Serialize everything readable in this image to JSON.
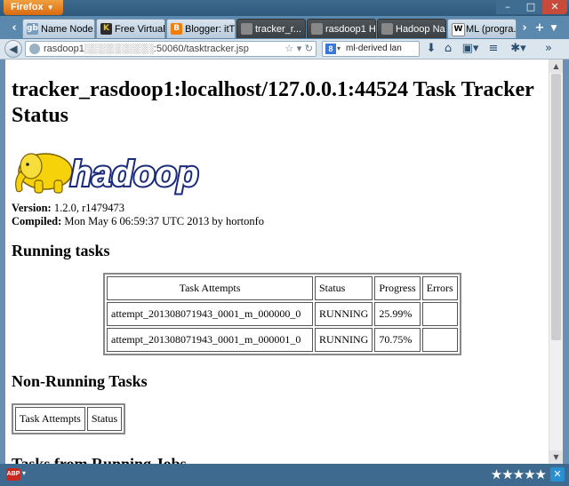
{
  "browser": {
    "menu_label": "Firefox",
    "url": "rasdoop1░░░░░░░░░░:50060/tasktracker.jsp",
    "search_value": "ml-derived lan",
    "tabs": [
      {
        "label": "Name Node...",
        "icon": "gb"
      },
      {
        "label": "Free Virtual ...",
        "icon": "K"
      },
      {
        "label": "Blogger: itT...",
        "icon": "B"
      },
      {
        "label": "tracker_r...",
        "icon": "page"
      },
      {
        "label": "rasdoop1 H...",
        "icon": "page"
      },
      {
        "label": "Hadoop Na...",
        "icon": "page"
      },
      {
        "label": "ML (progra...",
        "icon": "W"
      }
    ]
  },
  "page": {
    "title": "tracker_rasdoop1:localhost/127.0.0.1:44524 Task Tracker Status",
    "logo_text": "hadoop",
    "version_label": "Version:",
    "version_value": "1.2.0, r1479473",
    "compiled_label": "Compiled:",
    "compiled_value": "Mon May 6 06:59:37 UTC 2013 by hortonfo",
    "running_heading": "Running tasks",
    "running_headers": [
      "Task Attempts",
      "Status",
      "Progress",
      "Errors"
    ],
    "running_rows": [
      {
        "attempt": "attempt_201308071943_0001_m_000000_0",
        "status": "RUNNING",
        "progress": "25.99%",
        "errors": ""
      },
      {
        "attempt": "attempt_201308071943_0001_m_000001_0",
        "status": "RUNNING",
        "progress": "70.75%",
        "errors": ""
      }
    ],
    "nonrunning_heading": "Non-Running Tasks",
    "nonrunning_headers": [
      "Task Attempts",
      "Status"
    ],
    "jobs_heading": "Tasks from Running Jobs"
  },
  "statusbar": {
    "abp_label": "ABP",
    "rating": "★★★★★"
  },
  "colors": {
    "hadoop_blue": "#1a2a7a",
    "elephant_yellow": "#f5d20a"
  }
}
